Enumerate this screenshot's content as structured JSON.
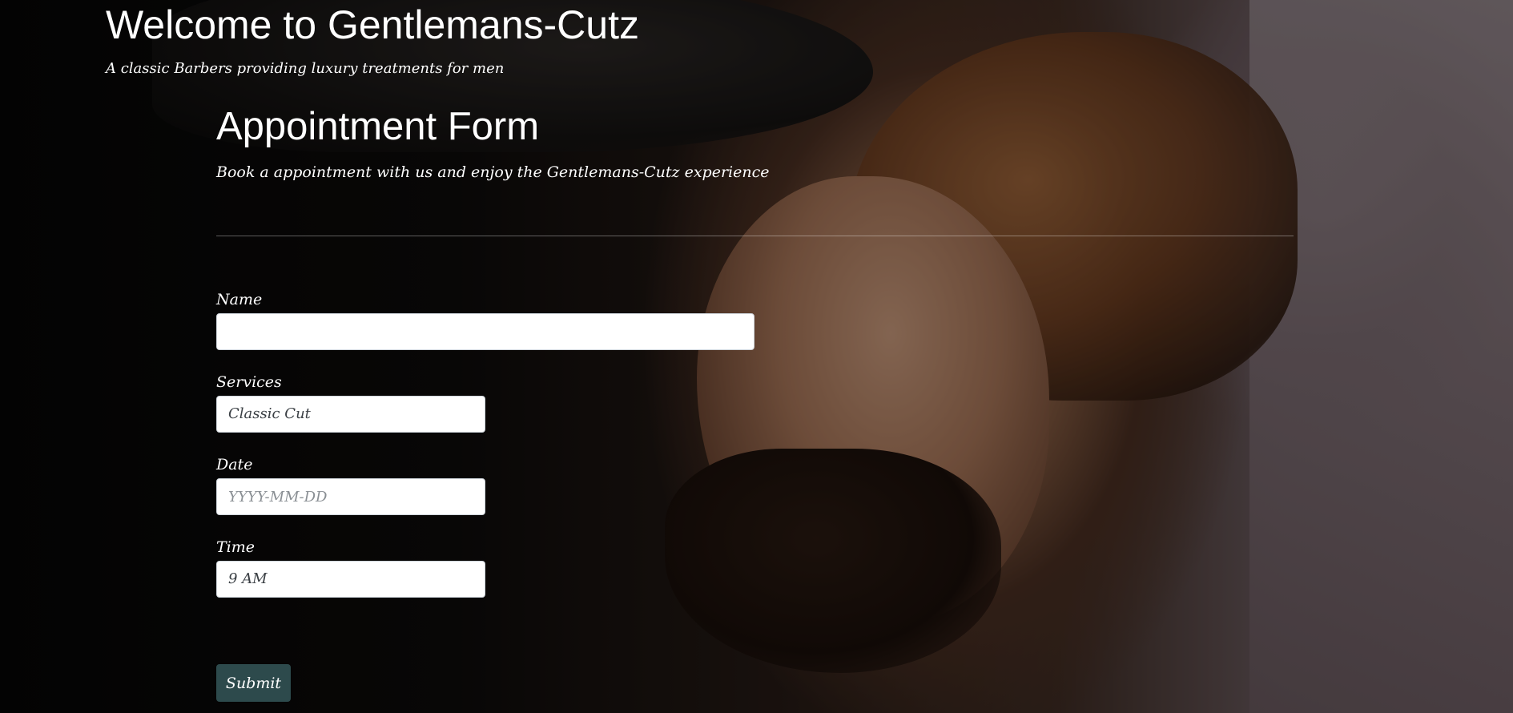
{
  "header": {
    "title": "Welcome to Gentlemans-Cutz",
    "tagline": "A classic Barbers providing luxury treatments for men"
  },
  "form": {
    "title": "Appointment Form",
    "subtitle": "Book a appointment with us and enjoy the Gentlemans-Cutz experience",
    "fields": {
      "name": {
        "label": "Name",
        "value": ""
      },
      "services": {
        "label": "Services",
        "selected": "Classic Cut"
      },
      "date": {
        "label": "Date",
        "placeholder": "YYYY-MM-DD",
        "value": ""
      },
      "time": {
        "label": "Time",
        "selected": "9 AM"
      }
    },
    "submit_label": "Submit"
  },
  "colors": {
    "submit_background": "#2d4a4c",
    "text": "#ffffff",
    "input_background": "#ffffff"
  }
}
